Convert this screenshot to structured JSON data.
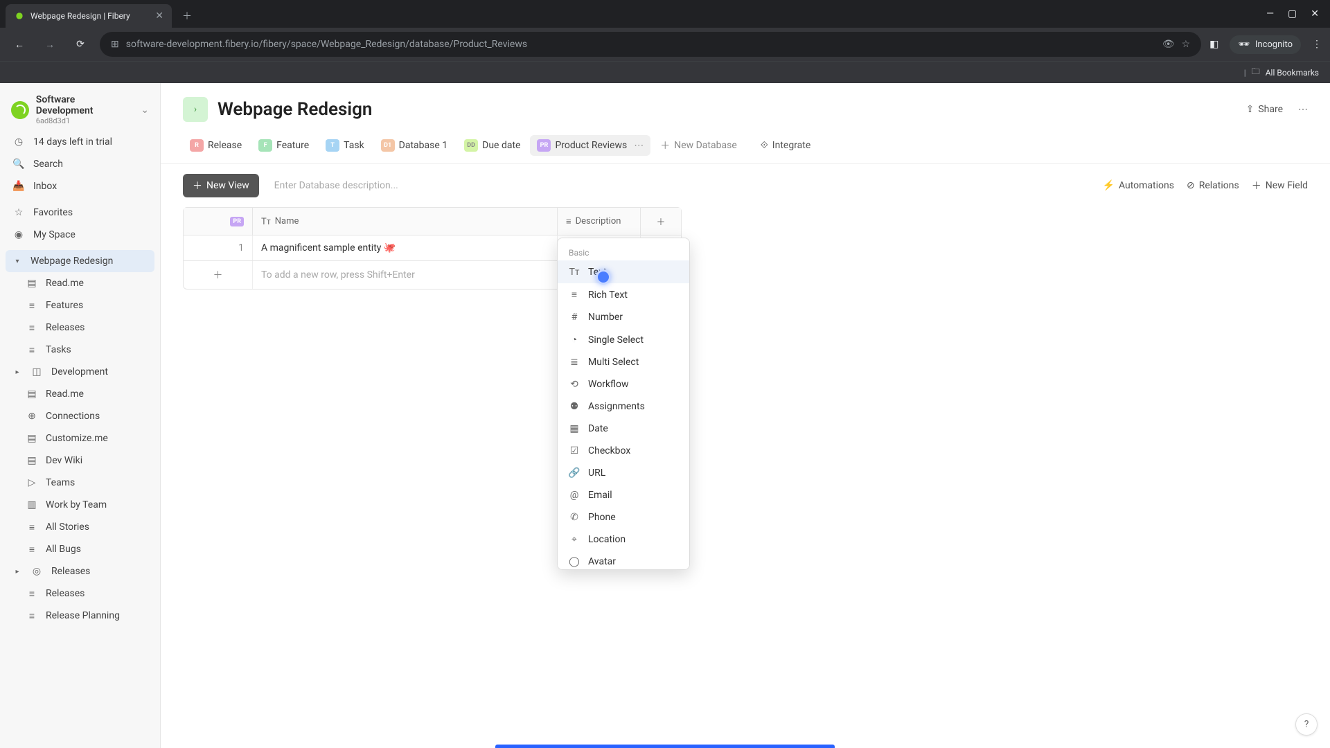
{
  "browser": {
    "tab_title": "Webpage Redesign | Fibery",
    "url": "software-development.fibery.io/fibery/space/Webpage_Redesign/database/Product_Reviews",
    "incognito": "Incognito",
    "bookmarks_link": "All Bookmarks"
  },
  "sidebar": {
    "workspace_name": "Software Development",
    "workspace_id": "6ad8d3d1",
    "trial": "14 days left in trial",
    "search": "Search",
    "inbox": "Inbox",
    "favorites": "Favorites",
    "myspace": "My Space",
    "tree": [
      {
        "label": "Webpage Redesign",
        "active": true,
        "children": [
          {
            "label": "Read.me",
            "icon": "doc"
          },
          {
            "label": "Features",
            "icon": "list"
          },
          {
            "label": "Releases",
            "icon": "list"
          },
          {
            "label": "Tasks",
            "icon": "list"
          }
        ]
      },
      {
        "label": "Development",
        "icon": "dev",
        "children": [
          {
            "label": "Read.me",
            "icon": "doc"
          },
          {
            "label": "Connections",
            "icon": "conn"
          },
          {
            "label": "Customize.me",
            "icon": "doc"
          },
          {
            "label": "Dev Wiki",
            "icon": "doc"
          },
          {
            "label": "Teams",
            "icon": "play"
          },
          {
            "label": "Work by Team",
            "icon": "bars"
          },
          {
            "label": "All Stories",
            "icon": "list"
          },
          {
            "label": "All Bugs",
            "icon": "list"
          }
        ]
      },
      {
        "label": "Releases",
        "icon": "rel",
        "children": [
          {
            "label": "Releases",
            "icon": "list"
          },
          {
            "label": "Release Planning",
            "icon": "list"
          }
        ]
      }
    ]
  },
  "page": {
    "title": "Webpage Redesign",
    "share": "Share"
  },
  "tabs": [
    {
      "label": "Release",
      "badge": "R",
      "cls": "r"
    },
    {
      "label": "Feature",
      "badge": "F",
      "cls": "f"
    },
    {
      "label": "Task",
      "badge": "T",
      "cls": "t"
    },
    {
      "label": "Database 1",
      "badge": "D1",
      "cls": "d"
    },
    {
      "label": "Due date",
      "badge": "DD",
      "cls": "dd"
    },
    {
      "label": "Product Reviews",
      "badge": "PR",
      "cls": "pr",
      "active": true
    }
  ],
  "actions": {
    "new_database": "New Database",
    "integrate": "Integrate",
    "new_view": "New View",
    "desc_placeholder": "Enter Database description...",
    "automations": "Automations",
    "relations": "Relations",
    "new_field": "New Field"
  },
  "table": {
    "col_name": "Name",
    "col_desc": "Description",
    "row1_idx": "1",
    "row1_name": "A magnificent sample entity 🐙",
    "add_row_hint": "To add a new row, press Shift+Enter",
    "pr_badge": "PR"
  },
  "dropdown": {
    "section": "Basic",
    "items": [
      {
        "label": "Text",
        "icon": "Tᴛ",
        "highlight": true
      },
      {
        "label": "Rich Text",
        "icon": "≡"
      },
      {
        "label": "Number",
        "icon": "#"
      },
      {
        "label": "Single Select",
        "icon": "◔"
      },
      {
        "label": "Multi Select",
        "icon": "≣"
      },
      {
        "label": "Workflow",
        "icon": "⟲"
      },
      {
        "label": "Assignments",
        "icon": "⚉"
      },
      {
        "label": "Date",
        "icon": "▦"
      },
      {
        "label": "Checkbox",
        "icon": "☑"
      },
      {
        "label": "URL",
        "icon": "🔗"
      },
      {
        "label": "Email",
        "icon": "@"
      },
      {
        "label": "Phone",
        "icon": "✆"
      },
      {
        "label": "Location",
        "icon": "⌖"
      },
      {
        "label": "Avatar",
        "icon": "◯"
      }
    ]
  }
}
